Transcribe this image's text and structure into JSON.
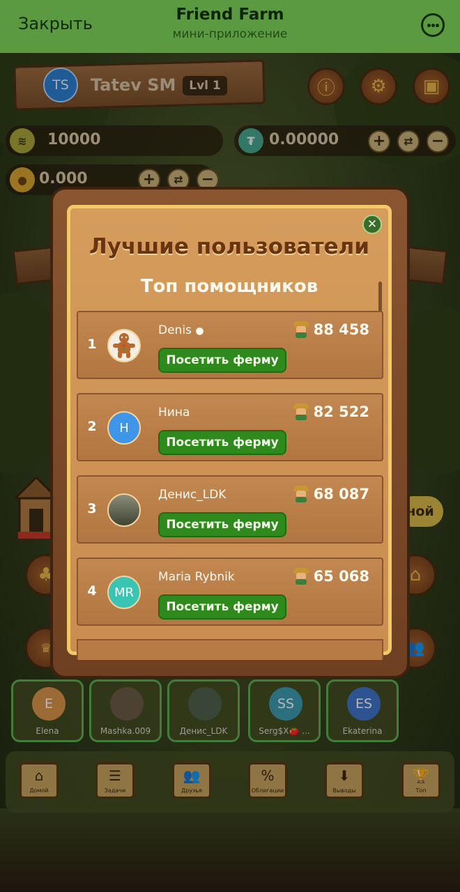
{
  "telegram": {
    "close_label": "Закрыть",
    "title": "Friend Farm",
    "subtitle": "мини-приложение"
  },
  "profile": {
    "initials": "TS",
    "username": "Tatev SM",
    "level": "Lvl 1"
  },
  "balances": {
    "coins": "10000",
    "usdt": "0.00000",
    "gold": "0.000"
  },
  "background_fragments": {
    "right_chip": "ной"
  },
  "modal": {
    "title": "Лучшие пользователи",
    "subtitle": "Топ помощников",
    "visit_label": "Посетить ферму",
    "entries": [
      {
        "rank": "1",
        "name": "Denis ",
        "score": "88 458",
        "initials": ""
      },
      {
        "rank": "2",
        "name": "Нина",
        "score": "82 522",
        "initials": "Н"
      },
      {
        "rank": "3",
        "name": "Денис_LDK",
        "score": "68 087",
        "initials": ""
      },
      {
        "rank": "4",
        "name": "Maria Rybnik",
        "score": "65 068",
        "initials": "MR"
      }
    ]
  },
  "friends": [
    {
      "initials": "E",
      "name": "Elena",
      "color": "#d9954a"
    },
    {
      "initials": "",
      "name": "Mashka.009",
      "color": "#6b5a48"
    },
    {
      "initials": "",
      "name": "Денис_LDK",
      "color": "#50604c"
    },
    {
      "initials": "SS",
      "name": "Serg$X🍅 ...",
      "color": "#3d9aaf"
    },
    {
      "initials": "ES",
      "name": "Ekaterina",
      "color": "#3f74c9"
    }
  ],
  "nav": [
    {
      "icon": "home-icon",
      "glyph": "⌂",
      "label": "Домой"
    },
    {
      "icon": "tasks-icon",
      "glyph": "☰",
      "label": "Задачи"
    },
    {
      "icon": "friends-icon",
      "glyph": "👥",
      "label": "Друзья"
    },
    {
      "icon": "bonds-icon",
      "glyph": "%",
      "label": "Облигации"
    },
    {
      "icon": "withdraw-icon",
      "glyph": "⬇",
      "label": "Выводы"
    },
    {
      "icon": "top-icon",
      "glyph": "🏆",
      "label": "Топ"
    }
  ],
  "colors": {
    "telegram_bar": "#7fd65b",
    "visit_button": "#2f8a1e",
    "board": "#d59c5c",
    "frame": "#7a4826"
  }
}
